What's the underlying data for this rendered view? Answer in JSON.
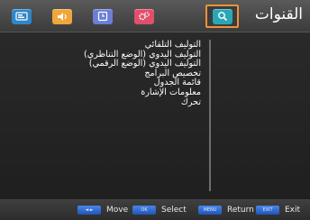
{
  "header": {
    "title": "القنوات",
    "tabs": [
      {
        "name": "picture-tab",
        "icon": "picture-icon",
        "color": "#2f86c9"
      },
      {
        "name": "sound-tab",
        "icon": "speaker-icon",
        "color": "#f0a63a"
      },
      {
        "name": "time-tab",
        "icon": "clock-icon",
        "color": "#6b7fd6"
      },
      {
        "name": "settings-tab",
        "icon": "gear-icon",
        "color": "#e24f6b"
      },
      {
        "name": "channel-tab",
        "icon": "search-icon",
        "color": "#2aa7b5",
        "active": true
      }
    ],
    "accent": "#f0913a"
  },
  "menu": {
    "items": [
      "التوليف التلقائي",
      "التوليف اليدوي (الوضع التناظري)",
      "التوليف اليدوي (الوضع الرقمي)",
      "تخصيص البرامج",
      "قائمة الجدول",
      "معلومات الإشارة",
      "تحرك"
    ]
  },
  "footer": {
    "hints": [
      {
        "key_label": "◄ ►",
        "label": "Move"
      },
      {
        "key_label": "OK",
        "label": "Select"
      },
      {
        "key_label": "MENU",
        "label": "Return"
      },
      {
        "key_label": "EXIT",
        "label": "Exit"
      }
    ]
  }
}
